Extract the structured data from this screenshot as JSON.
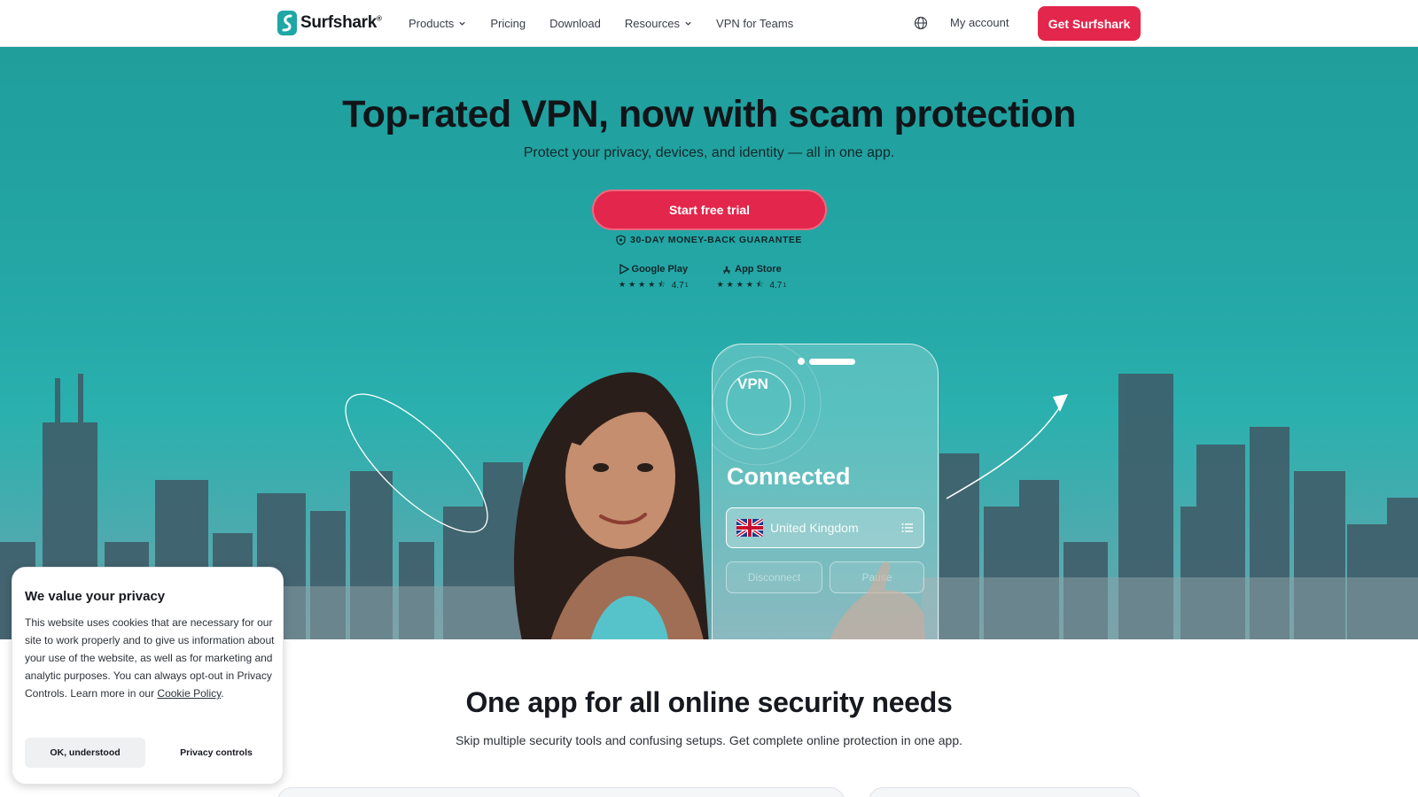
{
  "brand": {
    "name": "Surfshark",
    "accent": "#e3264b",
    "teal": "#24a7a6",
    "logo_mark_color": "#1ea7a4"
  },
  "nav": {
    "items": [
      {
        "label": "Products",
        "dropdown": true
      },
      {
        "label": "Pricing",
        "dropdown": false
      },
      {
        "label": "Download",
        "dropdown": false
      },
      {
        "label": "Resources",
        "dropdown": true
      },
      {
        "label": "VPN for Teams",
        "dropdown": false
      }
    ],
    "language_icon": "globe-icon",
    "account_label": "My account",
    "cta_label": "Get Surfshark"
  },
  "hero": {
    "title": "Top-rated VPN, now with scam protection",
    "subtitle": "Protect your privacy, devices, and identity — all in one app.",
    "cta_label": "Start free trial",
    "guarantee": "30-DAY MONEY-BACK GUARANTEE",
    "stores": [
      {
        "name": "Google Play",
        "icon": "google-play-icon",
        "rating": "4.7",
        "footnote": "1",
        "stars": 4.5
      },
      {
        "name": "App Store",
        "icon": "app-store-icon",
        "rating": "4.7",
        "footnote": "1",
        "stars": 4.5
      }
    ],
    "phone": {
      "vpn_label": "VPN",
      "status": "Connected",
      "location": "United Kingdom",
      "disconnect_label": "Disconnect",
      "pause_label": "Pause"
    }
  },
  "section": {
    "title": "One app for all online security needs",
    "subtitle": "Skip multiple security tools and confusing setups. Get complete online protection in one app."
  },
  "cookie": {
    "title": "We value your privacy",
    "text": "This website uses cookies that are necessary for our site to work properly and to give us information about your use of the website, as well as for marketing and analytic purposes. You can always opt-out in Privacy Controls. Learn more in our ",
    "link_label": "Cookie Policy",
    "text_end": ".",
    "ok_label": "OK, understood",
    "privacy_label": "Privacy controls"
  }
}
